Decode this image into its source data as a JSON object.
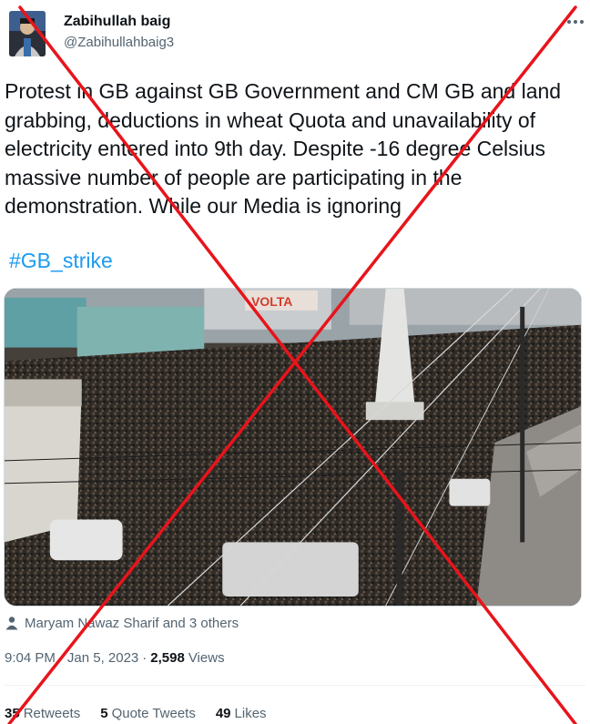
{
  "author": {
    "name": "Zabihullah baig",
    "handle": "@Zabihullahbaig3"
  },
  "more_icon": "more-dots-icon",
  "tweet": {
    "text": "Protest in GB against GB Government and CM GB and land grabbing, deductions in wheat Quota and unavailability of electricity entered into 9th day. Despite -16 degree Celsius massive number of people are participating in the demonstration. While our Media is ignoring",
    "hashtag": "#GB_strike"
  },
  "media": {
    "sign_text": "VOLTA"
  },
  "tagged": {
    "text": "Maryam Nawaz Sharif and 3 others"
  },
  "meta": {
    "time": "9:04 PM",
    "sep1": "·",
    "date": "Jan 5, 2023",
    "sep2": "·",
    "views_count": "2,598",
    "views_label": "Views"
  },
  "stats": {
    "retweets_count": "35",
    "retweets_label": "Retweets",
    "quotes_count": "5",
    "quotes_label": "Quote Tweets",
    "likes_count": "49",
    "likes_label": "Likes"
  },
  "overlay": {
    "type": "red-x-fake-stamp",
    "color": "#e8141b"
  }
}
